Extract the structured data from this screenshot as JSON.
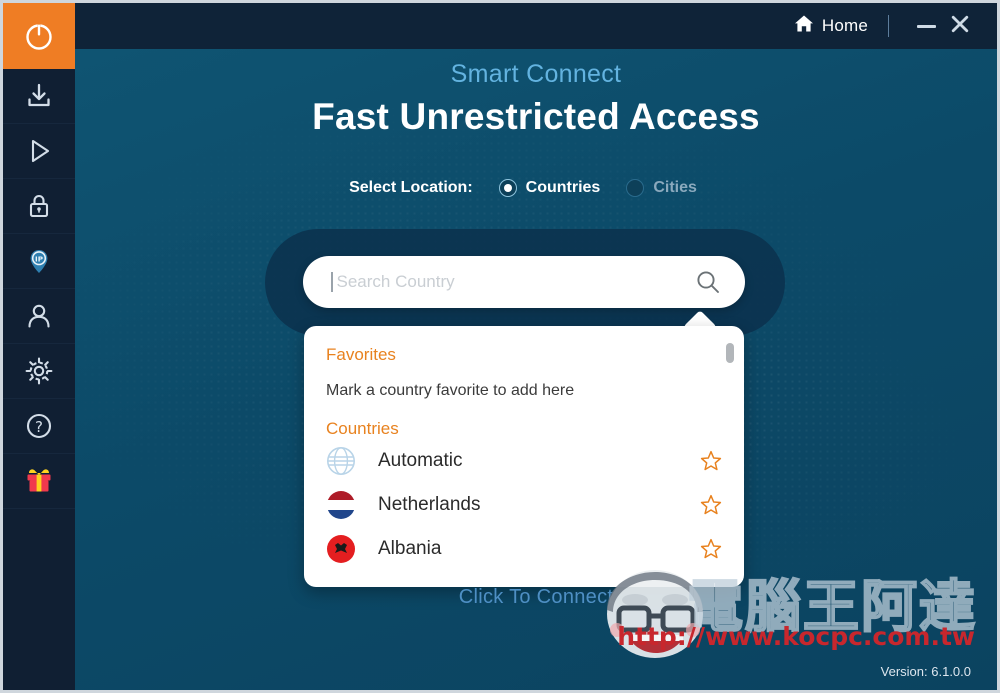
{
  "window": {
    "home_label": "Home",
    "minimize_icon": "minimize-icon",
    "close_icon": "close-icon",
    "home_icon": "home-icon"
  },
  "sidebar": {
    "items": [
      {
        "name": "power-button",
        "icon": "power-icon",
        "active": true
      },
      {
        "name": "download-button",
        "icon": "download-icon",
        "active": false
      },
      {
        "name": "streaming-button",
        "icon": "play-icon",
        "active": false
      },
      {
        "name": "security-button",
        "icon": "lock-icon",
        "active": false
      },
      {
        "name": "ip-location-button",
        "icon": "ip-pin-icon",
        "active": false
      },
      {
        "name": "account-button",
        "icon": "user-icon",
        "active": false
      },
      {
        "name": "settings-button",
        "icon": "gear-icon",
        "active": false
      },
      {
        "name": "help-button",
        "icon": "question-icon",
        "active": false
      },
      {
        "name": "rewards-button",
        "icon": "gift-icon",
        "active": false
      }
    ]
  },
  "main": {
    "subtitle": "Smart Connect",
    "headline": "Fast Unrestricted Access",
    "select_location_label": "Select Location:",
    "location_modes": [
      {
        "label": "Countries",
        "selected": true
      },
      {
        "label": "Cities",
        "selected": false
      }
    ],
    "search": {
      "placeholder": "Search Country",
      "value": "",
      "icon": "search-icon"
    },
    "dropdown": {
      "favorites_header": "Favorites",
      "favorites_empty_text": "Mark a country favorite to add here",
      "countries_header": "Countries",
      "countries": [
        {
          "name": "Automatic",
          "flag": "globe",
          "favorite": false
        },
        {
          "name": "Netherlands",
          "flag": "netherlands",
          "favorite": false
        },
        {
          "name": "Albania",
          "flag": "albania",
          "favorite": false
        }
      ]
    },
    "connect_hint": "Click To Connect",
    "version": "Version: 6.1.0.0"
  },
  "watermark": {
    "brand": "電腦王阿達",
    "url": "http://www.kocpc.com.tw"
  },
  "colors": {
    "accent_orange": "#ef7d24",
    "sidebar_bg": "#101f33",
    "stage_bg": "#0c4d6b",
    "header_bg": "#0f2338",
    "section_orange": "#e8821f",
    "subtitle_blue": "#63b3e0",
    "watermark_red": "#c8272d"
  }
}
